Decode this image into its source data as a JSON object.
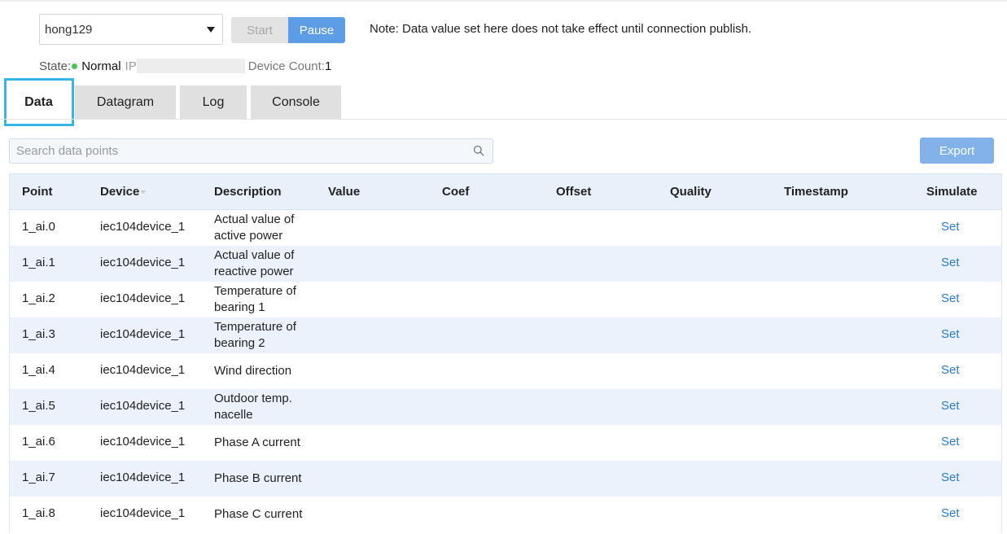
{
  "toolbar": {
    "connection_value": "hong129",
    "start_label": "Start",
    "pause_label": "Pause",
    "note": "Note: Data value set here does not take effect until connection publish."
  },
  "status": {
    "state_label": "State:",
    "state_value": "Normal",
    "ip_label": "IP",
    "device_count_label": "Device Count:",
    "device_count_value": "1"
  },
  "tabs": [
    {
      "label": "Data",
      "active": true
    },
    {
      "label": "Datagram",
      "active": false
    },
    {
      "label": "Log",
      "active": false
    },
    {
      "label": "Console",
      "active": false
    }
  ],
  "search": {
    "placeholder": "Search data points"
  },
  "export_label": "Export",
  "table": {
    "columns": [
      "Point",
      "Device",
      "Description",
      "Value",
      "Coef",
      "Offset",
      "Quality",
      "Timestamp",
      "Simulate"
    ],
    "rows": [
      {
        "point": "1_ai.0",
        "device": "iec104device_1",
        "desc1": "Actual value of",
        "desc2": "active power",
        "sim": "Set"
      },
      {
        "point": "1_ai.1",
        "device": "iec104device_1",
        "desc1": "Actual value of",
        "desc2": "reactive power",
        "sim": "Set"
      },
      {
        "point": "1_ai.2",
        "device": "iec104device_1",
        "desc1": "Temperature of",
        "desc2": "bearing 1",
        "sim": "Set"
      },
      {
        "point": "1_ai.3",
        "device": "iec104device_1",
        "desc1": "Temperature of",
        "desc2": "bearing 2",
        "sim": "Set"
      },
      {
        "point": "1_ai.4",
        "device": "iec104device_1",
        "desc1": "Wind direction",
        "desc2": "",
        "sim": "Set"
      },
      {
        "point": "1_ai.5",
        "device": "iec104device_1",
        "desc1": "Outdoor temp.",
        "desc2": "nacelle",
        "sim": "Set"
      },
      {
        "point": "1_ai.6",
        "device": "iec104device_1",
        "desc1": "Phase A current",
        "desc2": "",
        "sim": "Set"
      },
      {
        "point": "1_ai.7",
        "device": "iec104device_1",
        "desc1": "Phase B current",
        "desc2": "",
        "sim": "Set"
      },
      {
        "point": "1_ai.8",
        "device": "iec104device_1",
        "desc1": "Phase C current",
        "desc2": "",
        "sim": "Set"
      }
    ]
  },
  "colors": {
    "accent": "#5d9de5",
    "state_ok": "#4cc45a",
    "tab_highlight": "#35b6e6",
    "link": "#2b7bd1"
  }
}
